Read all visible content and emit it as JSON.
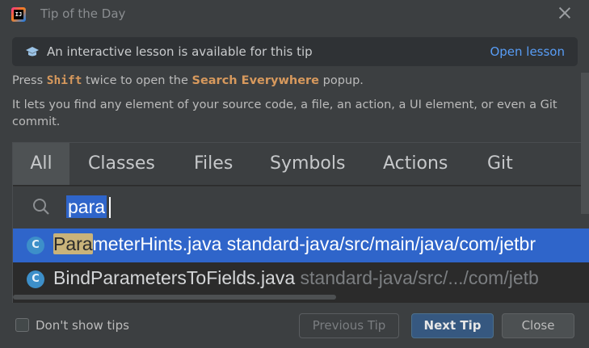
{
  "window": {
    "title": "Tip of the Day"
  },
  "banner": {
    "text": "An interactive lesson is available for this tip",
    "link": "Open lesson"
  },
  "tip": {
    "line1_pre": "Press ",
    "line1_key": "Shift",
    "line1_mid": " twice to open the ",
    "line1_feature": "Search Everywhere",
    "line1_post": " popup.",
    "line2": "It lets you find any element of your source code, a file, an action, a UI element, or even a Git commit."
  },
  "illustration": {
    "tabs": [
      "All",
      "Classes",
      "Files",
      "Symbols",
      "Actions",
      "Git"
    ],
    "active_tab": "All",
    "query": "para",
    "results": [
      {
        "icon": "C",
        "match": "Para",
        "rest": "meterHints.java",
        "path": " standard-java/src/main/java/com/jetbr"
      },
      {
        "icon": "C",
        "match": "",
        "rest": "BindParametersToFields.java",
        "path": " standard-java/src/.../com/jetb"
      }
    ]
  },
  "footer": {
    "checkbox_label": "Don't show tips",
    "checkbox_checked": false,
    "prev": "Previous Tip",
    "next": "Next Tip",
    "close": "Close"
  },
  "colors": {
    "accent": "#2f65ca",
    "link": "#589df6",
    "keyword": "#d7995d",
    "background": "#3c3f41"
  }
}
